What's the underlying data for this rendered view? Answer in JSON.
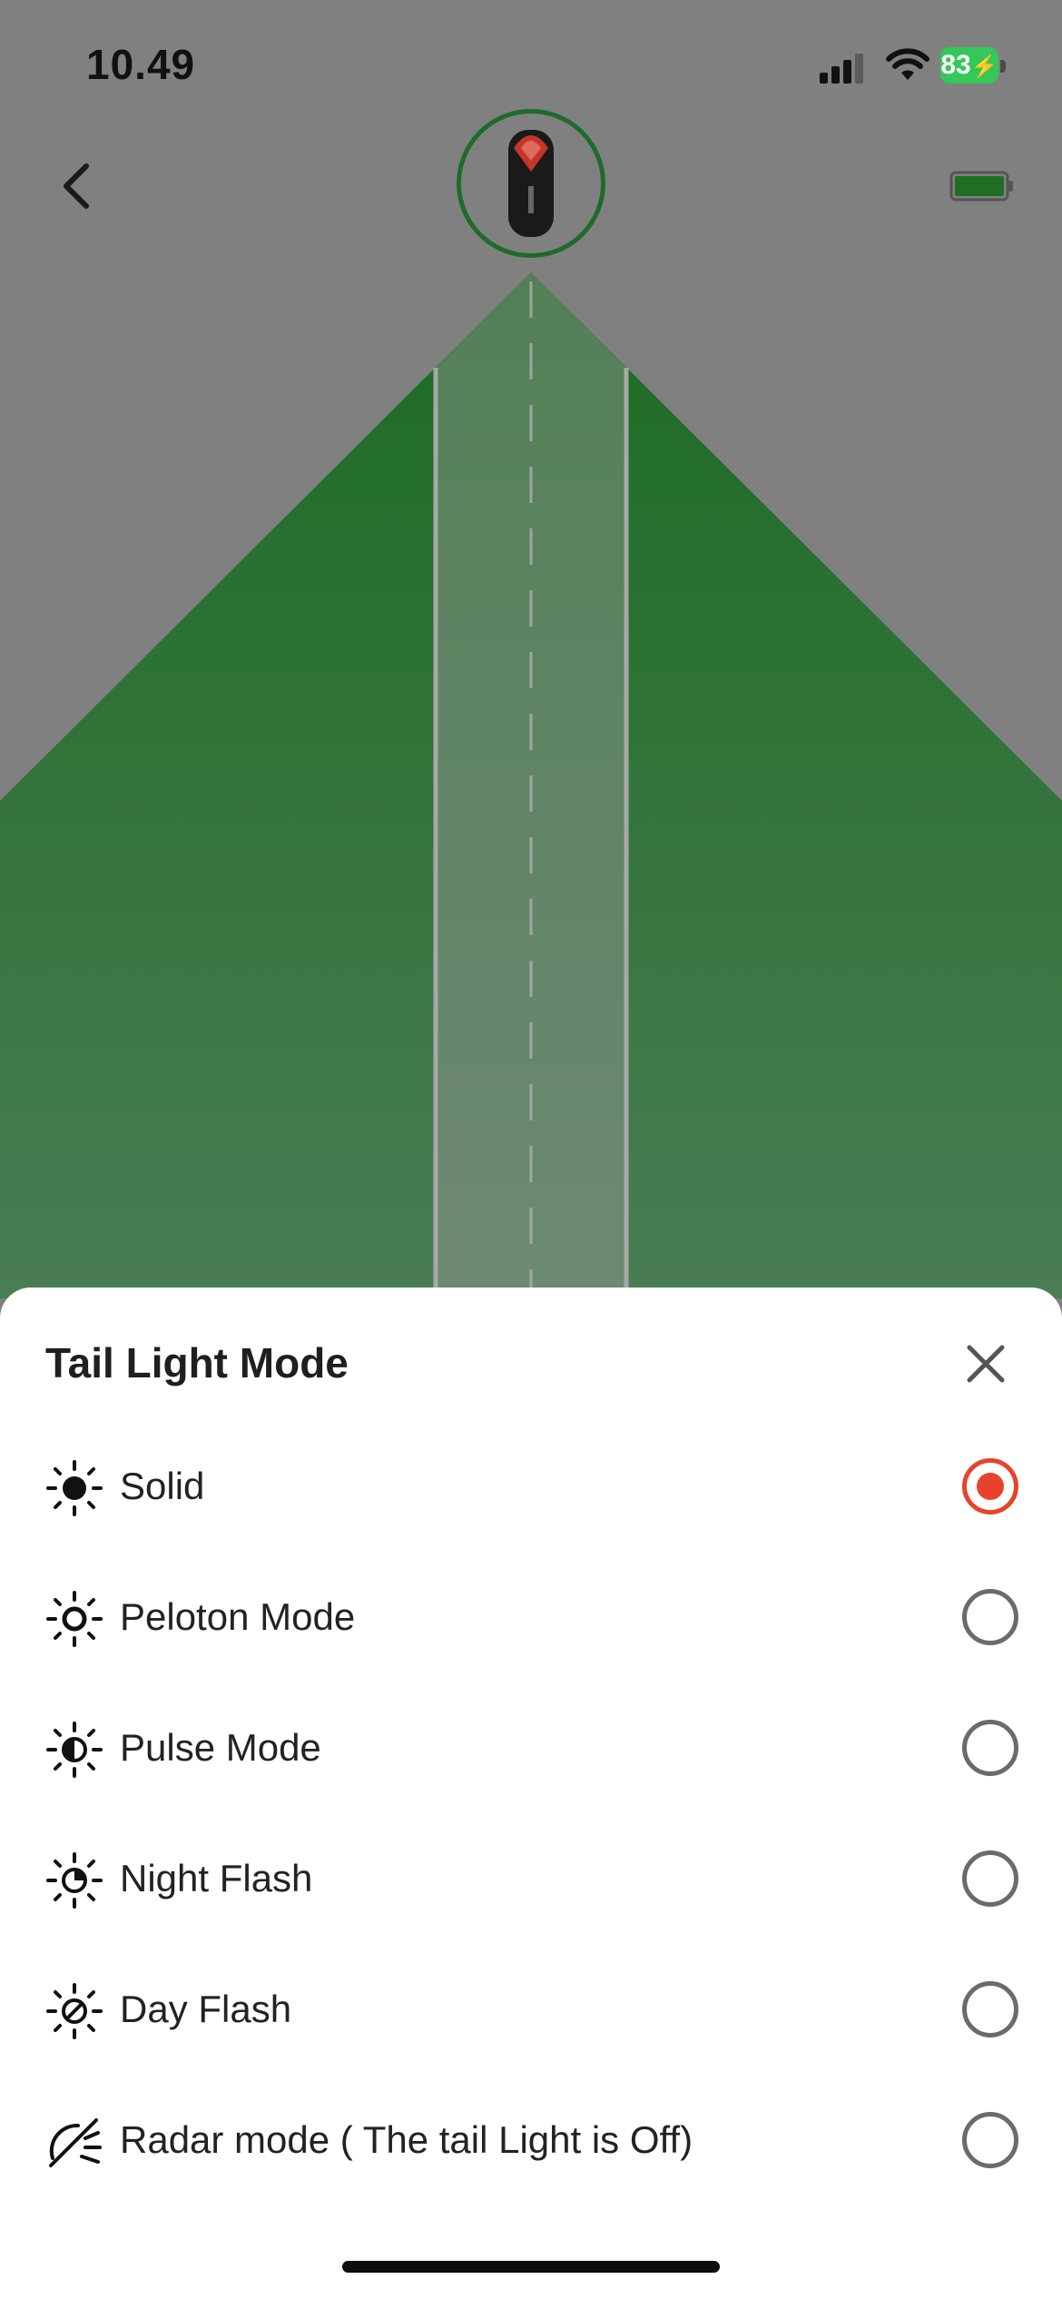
{
  "status_bar": {
    "time": "10.49",
    "battery_percent": "83"
  },
  "nav": {
    "back_icon": "chevron-left-icon",
    "device_icon": "tail-light-device",
    "device_battery_icon": "battery-full-icon",
    "device_battery_color": "#1f6e23"
  },
  "sheet": {
    "title": "Tail Light Mode",
    "close_icon": "close-icon",
    "options": [
      {
        "label": "Solid",
        "icon": "sun-solid-icon",
        "selected": true
      },
      {
        "label": "Peloton Mode",
        "icon": "sun-outline-icon",
        "selected": false
      },
      {
        "label": "Pulse Mode",
        "icon": "sun-half-icon",
        "selected": false
      },
      {
        "label": "Night Flash",
        "icon": "sun-moon-icon",
        "selected": false
      },
      {
        "label": "Day Flash",
        "icon": "sun-slash-icon",
        "selected": false
      },
      {
        "label": "Radar mode ( The tail Light is Off)",
        "icon": "radar-off-icon",
        "selected": false
      }
    ]
  },
  "colors": {
    "accent": "#e8432a",
    "field_green": "#1f6e23",
    "background_gray": "#808080"
  }
}
